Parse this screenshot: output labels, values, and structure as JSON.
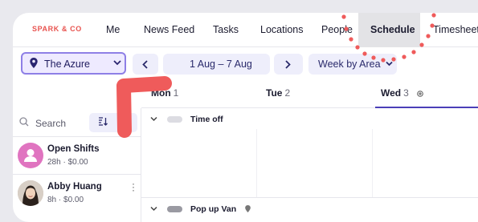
{
  "brand": {
    "logo_text": "SPARK & CO"
  },
  "nav": {
    "items": [
      {
        "label": "Me"
      },
      {
        "label": "News Feed"
      },
      {
        "label": "Tasks"
      },
      {
        "label": "Locations"
      },
      {
        "label": "People"
      },
      {
        "label": "Schedule"
      },
      {
        "label": "Timesheets"
      }
    ],
    "active": "Schedule"
  },
  "toolbar": {
    "location_label": "The Azure",
    "date_range": "1 Aug – 7 Aug",
    "view_label": "Week by Area"
  },
  "search": {
    "placeholder": "Search"
  },
  "people": [
    {
      "name": "Open Shifts",
      "meta": "28h · $0.00"
    },
    {
      "name": "Abby Huang",
      "meta": "8h · $0.00"
    }
  ],
  "days": [
    {
      "name": "Mon",
      "num": "1"
    },
    {
      "name": "Tue",
      "num": "2"
    },
    {
      "name": "Wed",
      "num": "3"
    }
  ],
  "groups": [
    {
      "title": "Time off"
    },
    {
      "title": "Pop up Van"
    }
  ],
  "colors": {
    "accent": "#4b3fb8",
    "brand": "#e8534f",
    "annotation": "#ef5b5b",
    "open_shifts_avatar": "#e074c0"
  },
  "icons": {
    "location": "map-pin-icon",
    "sort": "sort-icon",
    "search": "search-icon",
    "prev": "chevron-left-icon",
    "next": "chevron-right-icon"
  }
}
